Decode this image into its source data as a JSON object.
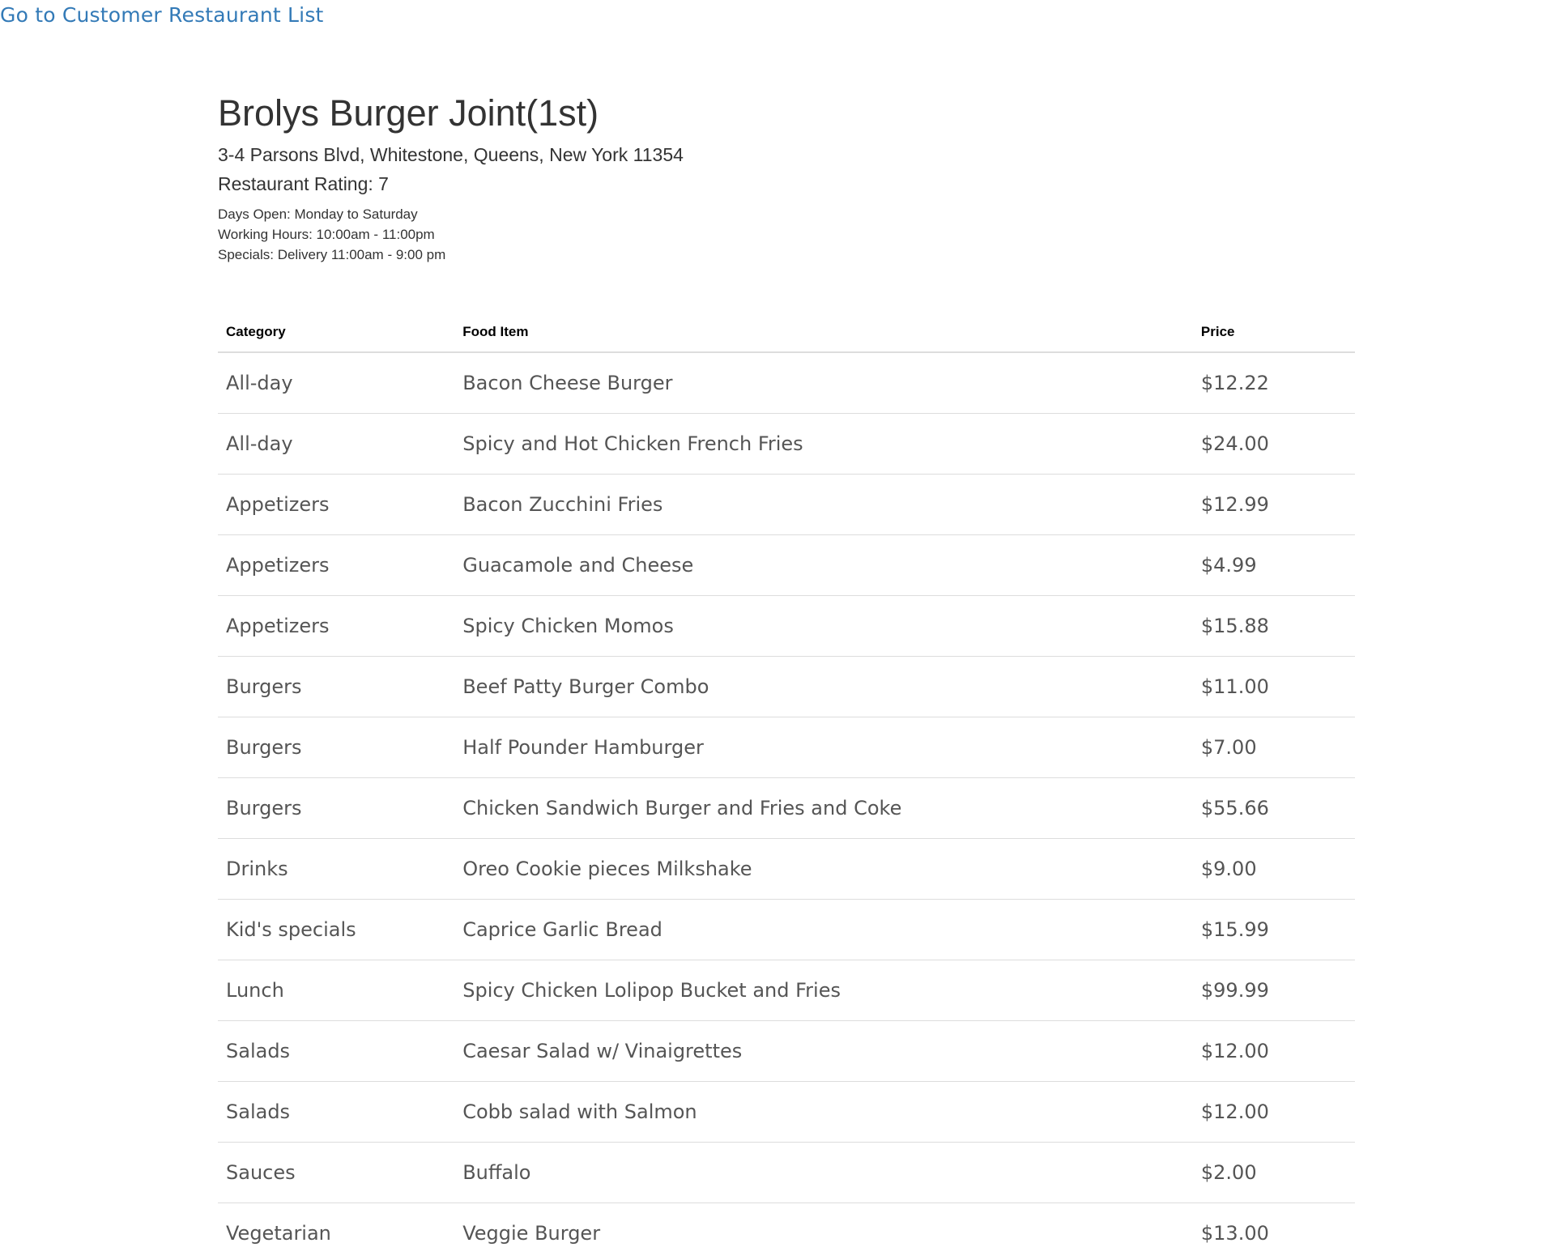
{
  "nav": {
    "back_link": "Go to Customer Restaurant List"
  },
  "restaurant": {
    "name": "Brolys Burger Joint(1st)",
    "address": "3-4 Parsons Blvd, Whitestone, Queens, New York 11354",
    "rating": "Restaurant Rating: 7",
    "days_open": "Days Open: Monday to Saturday",
    "working_hours": "Working Hours: 10:00am - 11:00pm",
    "specials": "Specials: Delivery 11:00am - 9:00 pm"
  },
  "menu": {
    "headers": {
      "category": "Category",
      "food_item": "Food Item",
      "price": "Price"
    },
    "rows": [
      {
        "category": "All-day",
        "item": "Bacon Cheese Burger",
        "price": "$12.22"
      },
      {
        "category": "All-day",
        "item": "Spicy and Hot Chicken French Fries",
        "price": "$24.00"
      },
      {
        "category": "Appetizers",
        "item": "Bacon Zucchini Fries",
        "price": "$12.99"
      },
      {
        "category": "Appetizers",
        "item": "Guacamole and Cheese",
        "price": "$4.99"
      },
      {
        "category": "Appetizers",
        "item": "Spicy Chicken Momos",
        "price": "$15.88"
      },
      {
        "category": "Burgers",
        "item": "Beef Patty Burger Combo",
        "price": "$11.00"
      },
      {
        "category": "Burgers",
        "item": "Half Pounder Hamburger",
        "price": "$7.00"
      },
      {
        "category": "Burgers",
        "item": "Chicken Sandwich Burger and Fries and Coke",
        "price": "$55.66"
      },
      {
        "category": "Drinks",
        "item": "Oreo Cookie pieces Milkshake",
        "price": "$9.00"
      },
      {
        "category": "Kid's specials",
        "item": "Caprice Garlic Bread",
        "price": "$15.99"
      },
      {
        "category": "Lunch",
        "item": "Spicy Chicken Lolipop Bucket and Fries",
        "price": "$99.99"
      },
      {
        "category": "Salads",
        "item": "Caesar Salad w/ Vinaigrettes",
        "price": "$12.00"
      },
      {
        "category": "Salads",
        "item": "Cobb salad with Salmon",
        "price": "$12.00"
      },
      {
        "category": "Sauces",
        "item": "Buffalo",
        "price": "$2.00"
      },
      {
        "category": "Vegetarian",
        "item": "Veggie Burger",
        "price": "$13.00"
      }
    ]
  },
  "colors": {
    "link": "#337ab7",
    "text": "#333333",
    "cell_text": "#555555",
    "border": "#dddddd"
  }
}
